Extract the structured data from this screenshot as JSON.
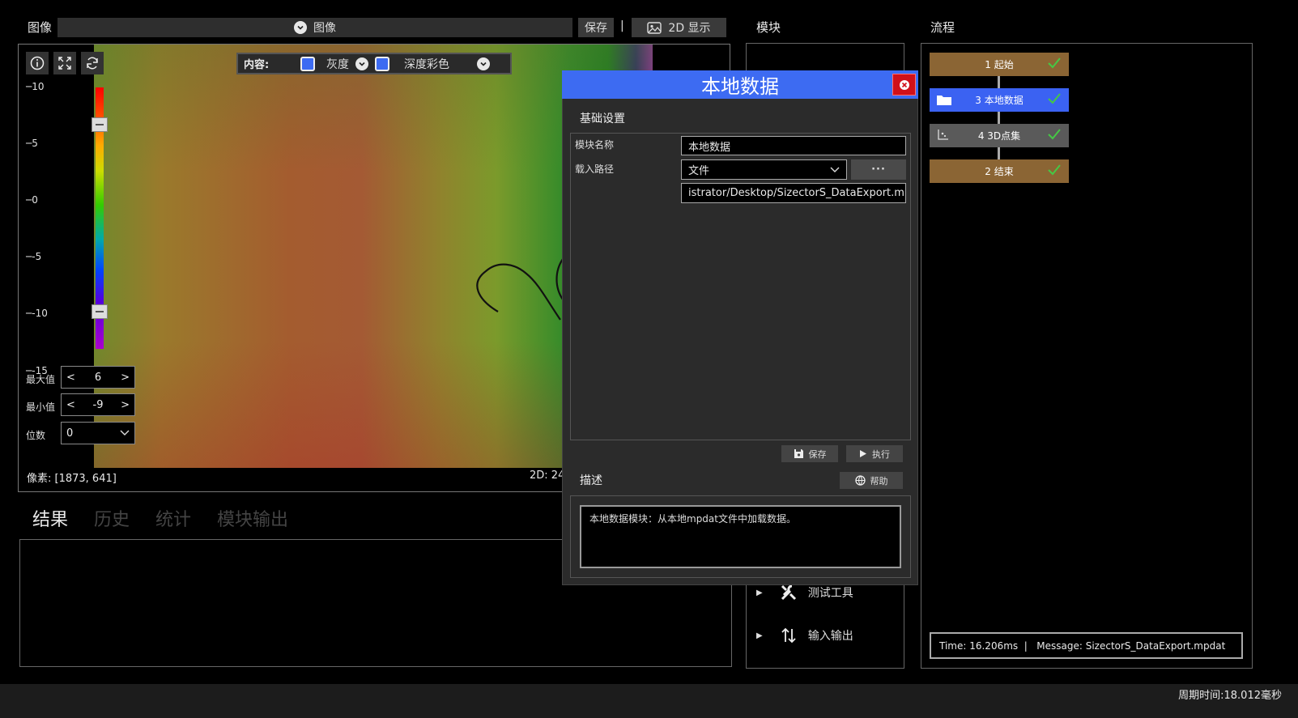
{
  "image_panel": {
    "title": "图像",
    "dropdown_value": "图像",
    "save_label": "保存",
    "separator": "|",
    "display_button_label": "2D 显示",
    "content_label": "内容:",
    "gray_label": "灰度",
    "depth_color_label": "深度彩色",
    "ticks": [
      "10",
      "5",
      "0",
      "-5",
      "-10",
      "-15"
    ],
    "max_label": "最大值",
    "max_value": "6",
    "min_label": "最小值",
    "min_value": "-9",
    "digits_label": "位数",
    "digits_value": "0",
    "pixel_readout": "像素: [1873, 641]",
    "readout_2d": "2D: 24"
  },
  "results": {
    "tabs": [
      "结果",
      "历史",
      "统计",
      "模块输出"
    ]
  },
  "modules": {
    "title": "模块",
    "items": [
      {
        "label": "测试工具",
        "icon": "tools-icon"
      },
      {
        "label": "输入输出",
        "icon": "arrows-updown-icon"
      }
    ]
  },
  "dialog": {
    "title": "本地数据",
    "section_basic": "基础设置",
    "module_name_label": "模块名称",
    "module_name_value": "本地数据",
    "load_path_label": "载入路径",
    "load_type_value": "文件",
    "browse_label": "···",
    "path_value": "istrator/Desktop/SizectorS_DataExport.mpdat",
    "save_label": "保存",
    "run_label": "执行",
    "section_desc": "描述",
    "help_label": "帮助",
    "description": "本地数据模块：从本地mpdat文件中加载数据。"
  },
  "flow": {
    "title": "流程",
    "nodes": [
      {
        "label": "1 起始",
        "style": "brown"
      },
      {
        "label": "3 本地数据",
        "style": "blue"
      },
      {
        "label": "4 3D点集",
        "style": "gray"
      },
      {
        "label": "2 结束",
        "style": "brown"
      }
    ],
    "status": "Time: 16.206ms  |   Message: SizectorS_DataExport.mpdat"
  },
  "status_bar": {
    "cycle_time": "周期时间:18.012毫秒"
  },
  "colors": {
    "accent_blue": "#3d6bf2",
    "node_brown": "#8b6534",
    "check_green": "#45c845",
    "close_red": "#d0101a"
  }
}
